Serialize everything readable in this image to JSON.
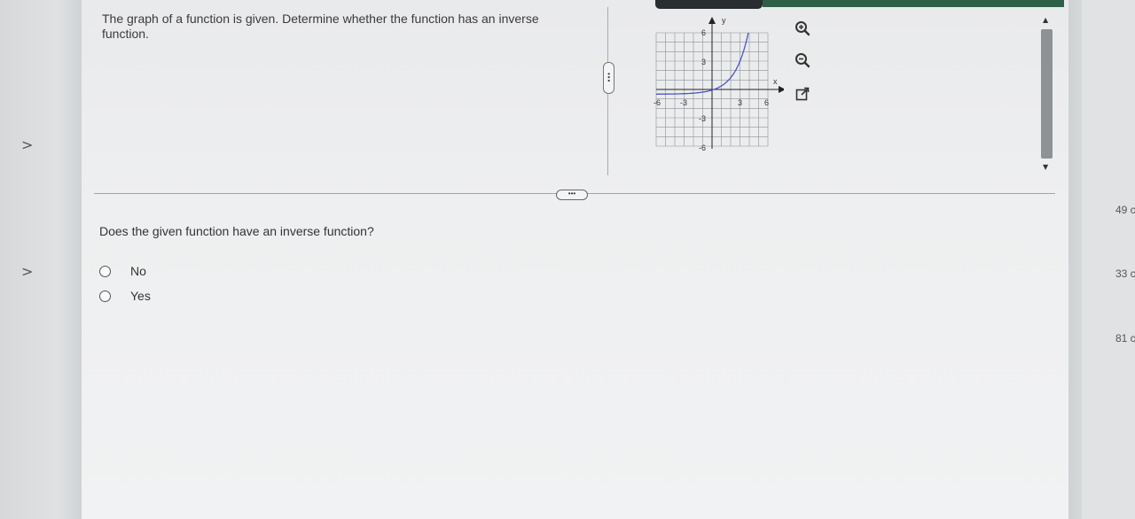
{
  "question": {
    "instruction": "The graph of a function is given. Determine whether the function has an inverse function.",
    "prompt": "Does the given function have an inverse function?",
    "options": [
      {
        "label": "No",
        "selected": false
      },
      {
        "label": "Yes",
        "selected": false
      }
    ]
  },
  "graph": {
    "x_axis_label": "x",
    "y_axis_label": "y",
    "x_tick_labels": [
      "-6",
      "-3",
      "3",
      "6"
    ],
    "y_tick_labels": [
      "6",
      "3",
      "-3",
      "-6"
    ],
    "x_range": [
      -6,
      6
    ],
    "y_range": [
      -6,
      6
    ],
    "curve_color": "#4a55c8"
  },
  "tools": [
    {
      "name": "zoom-in-icon"
    },
    {
      "name": "zoom-out-icon"
    },
    {
      "name": "external-link-icon"
    }
  ],
  "side_scores": [
    "49 c",
    "33 c",
    "81 c"
  ],
  "colors": {
    "accent_bar": "#2f5f46",
    "curve": "#4a55c8"
  }
}
